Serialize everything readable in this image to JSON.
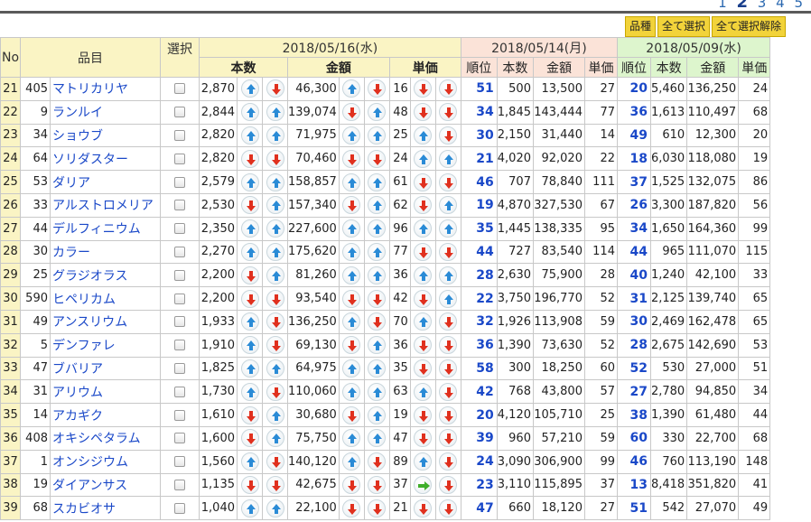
{
  "pager": {
    "current": "2",
    "pages": [
      "1",
      "2",
      "3",
      "4",
      "5"
    ]
  },
  "buttons": {
    "category": "品種",
    "select_all": "全て選択",
    "deselect_all": "全て選択解除"
  },
  "header": {
    "no": "No",
    "item": "品目",
    "select": "選択",
    "date1": "2018/05/16(水)",
    "date2": "2018/05/14(月)",
    "date3": "2018/05/09(水)",
    "qty": "本数",
    "amount": "金額",
    "unit_price": "単価",
    "rank": "順位",
    "qty_s": "本数",
    "amount_s": "金額",
    "unit_s": "単価"
  },
  "rows": [
    {
      "no": "21",
      "code": "405",
      "name": "マトリカリヤ",
      "q": "2,870",
      "qa": [
        "up",
        "dn"
      ],
      "amt": "46,300",
      "aa": [
        "up",
        "dn"
      ],
      "up": "16",
      "ua": [
        "dn",
        "dn"
      ],
      "r2": "51",
      "q2": "500",
      "a2": "13,500",
      "u2": "27",
      "r3": "20",
      "q3": "5,460",
      "a3": "136,250",
      "u3": "24"
    },
    {
      "no": "22",
      "code": "9",
      "name": "ランルイ",
      "q": "2,844",
      "qa": [
        "up",
        "up"
      ],
      "amt": "139,074",
      "aa": [
        "dn",
        "up"
      ],
      "up": "48",
      "ua": [
        "dn",
        "dn"
      ],
      "r2": "34",
      "q2": "1,845",
      "a2": "143,444",
      "u2": "77",
      "r3": "36",
      "q3": "1,613",
      "a3": "110,497",
      "u3": "68"
    },
    {
      "no": "23",
      "code": "34",
      "name": "ショウブ",
      "q": "2,820",
      "qa": [
        "up",
        "up"
      ],
      "amt": "71,975",
      "aa": [
        "up",
        "up"
      ],
      "up": "25",
      "ua": [
        "up",
        "dn"
      ],
      "r2": "30",
      "q2": "2,150",
      "a2": "31,440",
      "u2": "14",
      "r3": "49",
      "q3": "610",
      "a3": "12,300",
      "u3": "20"
    },
    {
      "no": "24",
      "code": "64",
      "name": "ソリダスター",
      "q": "2,820",
      "qa": [
        "dn",
        "dn"
      ],
      "amt": "70,460",
      "aa": [
        "dn",
        "dn"
      ],
      "up": "24",
      "ua": [
        "up",
        "up"
      ],
      "r2": "21",
      "q2": "4,020",
      "a2": "92,020",
      "u2": "22",
      "r3": "18",
      "q3": "6,030",
      "a3": "118,080",
      "u3": "19"
    },
    {
      "no": "25",
      "code": "53",
      "name": "ダリア",
      "q": "2,579",
      "qa": [
        "up",
        "up"
      ],
      "amt": "158,857",
      "aa": [
        "up",
        "up"
      ],
      "up": "61",
      "ua": [
        "dn",
        "dn"
      ],
      "r2": "46",
      "q2": "707",
      "a2": "78,840",
      "u2": "111",
      "r3": "37",
      "q3": "1,525",
      "a3": "132,075",
      "u3": "86"
    },
    {
      "no": "26",
      "code": "33",
      "name": "アルストロメリア",
      "q": "2,530",
      "qa": [
        "dn",
        "up"
      ],
      "amt": "157,340",
      "aa": [
        "dn",
        "up"
      ],
      "up": "62",
      "ua": [
        "dn",
        "up"
      ],
      "r2": "19",
      "q2": "4,870",
      "a2": "327,530",
      "u2": "67",
      "r3": "26",
      "q3": "3,300",
      "a3": "187,820",
      "u3": "56"
    },
    {
      "no": "27",
      "code": "44",
      "name": "デルフィニウム",
      "q": "2,350",
      "qa": [
        "up",
        "up"
      ],
      "amt": "227,600",
      "aa": [
        "up",
        "up"
      ],
      "up": "96",
      "ua": [
        "up",
        "up"
      ],
      "r2": "35",
      "q2": "1,445",
      "a2": "138,335",
      "u2": "95",
      "r3": "34",
      "q3": "1,650",
      "a3": "164,360",
      "u3": "99"
    },
    {
      "no": "28",
      "code": "30",
      "name": "カラー",
      "q": "2,270",
      "qa": [
        "up",
        "up"
      ],
      "amt": "175,620",
      "aa": [
        "up",
        "up"
      ],
      "up": "77",
      "ua": [
        "dn",
        "dn"
      ],
      "r2": "44",
      "q2": "727",
      "a2": "83,540",
      "u2": "114",
      "r3": "44",
      "q3": "965",
      "a3": "111,070",
      "u3": "115"
    },
    {
      "no": "29",
      "code": "25",
      "name": "グラジオラス",
      "q": "2,200",
      "qa": [
        "dn",
        "up"
      ],
      "amt": "81,260",
      "aa": [
        "up",
        "up"
      ],
      "up": "36",
      "ua": [
        "up",
        "up"
      ],
      "r2": "28",
      "q2": "2,630",
      "a2": "75,900",
      "u2": "28",
      "r3": "40",
      "q3": "1,240",
      "a3": "42,100",
      "u3": "33"
    },
    {
      "no": "30",
      "code": "590",
      "name": "ヒペリカム",
      "q": "2,200",
      "qa": [
        "dn",
        "dn"
      ],
      "amt": "93,540",
      "aa": [
        "dn",
        "dn"
      ],
      "up": "42",
      "ua": [
        "dn",
        "up"
      ],
      "r2": "22",
      "q2": "3,750",
      "a2": "196,770",
      "u2": "52",
      "r3": "31",
      "q3": "2,125",
      "a3": "139,740",
      "u3": "65"
    },
    {
      "no": "31",
      "code": "49",
      "name": "アンスリウム",
      "q": "1,933",
      "qa": [
        "up",
        "dn"
      ],
      "amt": "136,250",
      "aa": [
        "up",
        "dn"
      ],
      "up": "70",
      "ua": [
        "up",
        "dn"
      ],
      "r2": "32",
      "q2": "1,926",
      "a2": "113,908",
      "u2": "59",
      "r3": "30",
      "q3": "2,469",
      "a3": "162,478",
      "u3": "65"
    },
    {
      "no": "32",
      "code": "5",
      "name": "デンファレ",
      "q": "1,910",
      "qa": [
        "up",
        "dn"
      ],
      "amt": "69,130",
      "aa": [
        "dn",
        "up"
      ],
      "up": "36",
      "ua": [
        "dn",
        "dn"
      ],
      "r2": "36",
      "q2": "1,390",
      "a2": "73,630",
      "u2": "52",
      "r3": "28",
      "q3": "2,675",
      "a3": "142,690",
      "u3": "53"
    },
    {
      "no": "33",
      "code": "47",
      "name": "ブバリア",
      "q": "1,825",
      "qa": [
        "up",
        "up"
      ],
      "amt": "64,975",
      "aa": [
        "up",
        "up"
      ],
      "up": "35",
      "ua": [
        "dn",
        "dn"
      ],
      "r2": "58",
      "q2": "300",
      "a2": "18,250",
      "u2": "60",
      "r3": "52",
      "q3": "530",
      "a3": "27,000",
      "u3": "51"
    },
    {
      "no": "34",
      "code": "31",
      "name": "アリウム",
      "q": "1,730",
      "qa": [
        "up",
        "dn"
      ],
      "amt": "110,060",
      "aa": [
        "up",
        "up"
      ],
      "up": "63",
      "ua": [
        "up",
        "dn"
      ],
      "r2": "42",
      "q2": "768",
      "a2": "43,800",
      "u2": "57",
      "r3": "27",
      "q3": "2,780",
      "a3": "94,850",
      "u3": "34"
    },
    {
      "no": "35",
      "code": "14",
      "name": "アカギク",
      "q": "1,610",
      "qa": [
        "dn",
        "up"
      ],
      "amt": "30,680",
      "aa": [
        "dn",
        "up"
      ],
      "up": "19",
      "ua": [
        "dn",
        "dn"
      ],
      "r2": "20",
      "q2": "4,120",
      "a2": "105,710",
      "u2": "25",
      "r3": "38",
      "q3": "1,390",
      "a3": "61,480",
      "u3": "44"
    },
    {
      "no": "36",
      "code": "408",
      "name": "オキシペタラム",
      "q": "1,600",
      "qa": [
        "dn",
        "up"
      ],
      "amt": "75,750",
      "aa": [
        "up",
        "up"
      ],
      "up": "47",
      "ua": [
        "dn",
        "dn"
      ],
      "r2": "39",
      "q2": "960",
      "a2": "57,210",
      "u2": "59",
      "r3": "60",
      "q3": "330",
      "a3": "22,700",
      "u3": "68"
    },
    {
      "no": "37",
      "code": "1",
      "name": "オンシジウム",
      "q": "1,560",
      "qa": [
        "up",
        "dn"
      ],
      "amt": "140,120",
      "aa": [
        "up",
        "dn"
      ],
      "up": "89",
      "ua": [
        "up",
        "dn"
      ],
      "r2": "24",
      "q2": "3,090",
      "a2": "306,900",
      "u2": "99",
      "r3": "46",
      "q3": "760",
      "a3": "113,190",
      "u3": "148"
    },
    {
      "no": "38",
      "code": "19",
      "name": "ダイアンサス",
      "q": "1,135",
      "qa": [
        "dn",
        "dn"
      ],
      "amt": "42,675",
      "aa": [
        "dn",
        "dn"
      ],
      "up": "37",
      "ua": [
        "fl",
        "dn"
      ],
      "r2": "23",
      "q2": "3,110",
      "a2": "115,895",
      "u2": "37",
      "r3": "13",
      "q3": "8,418",
      "a3": "351,820",
      "u3": "41"
    },
    {
      "no": "39",
      "code": "68",
      "name": "スカビオサ",
      "q": "1,040",
      "qa": [
        "up",
        "up"
      ],
      "amt": "22,100",
      "aa": [
        "dn",
        "dn"
      ],
      "up": "21",
      "ua": [
        "dn",
        "dn"
      ],
      "r2": "47",
      "q2": "660",
      "a2": "18,120",
      "u2": "27",
      "r3": "51",
      "q3": "542",
      "a3": "27,070",
      "u3": "49"
    }
  ]
}
